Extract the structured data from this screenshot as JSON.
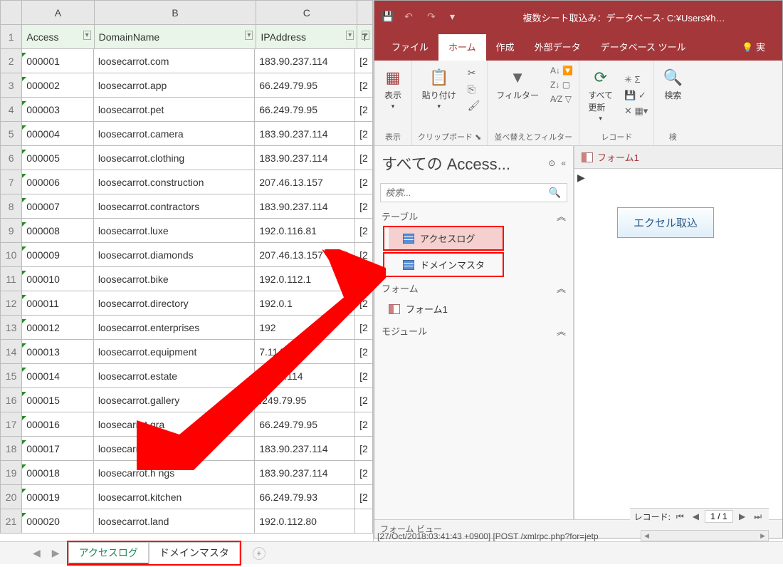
{
  "excel": {
    "columns": [
      "A",
      "B",
      "C",
      ""
    ],
    "headers": [
      "Access",
      "DomainName",
      "IPAddress",
      ""
    ],
    "rows": [
      {
        "n": "1"
      },
      {
        "n": "2",
        "a": "000001",
        "b": "loosecarrot.com",
        "c": "183.90.237.114",
        "d": "[2"
      },
      {
        "n": "3",
        "a": "000002",
        "b": "loosecarrot.app",
        "c": "66.249.79.95",
        "d": "[2"
      },
      {
        "n": "4",
        "a": "000003",
        "b": "loosecarrot.pet",
        "c": "66.249.79.95",
        "d": "[2"
      },
      {
        "n": "5",
        "a": "000004",
        "b": "loosecarrot.camera",
        "c": "183.90.237.114",
        "d": "[2"
      },
      {
        "n": "6",
        "a": "000005",
        "b": "loosecarrot.clothing",
        "c": "183.90.237.114",
        "d": "[2"
      },
      {
        "n": "7",
        "a": "000006",
        "b": "loosecarrot.construction",
        "c": "207.46.13.157",
        "d": "[2"
      },
      {
        "n": "8",
        "a": "000007",
        "b": "loosecarrot.contractors",
        "c": "183.90.237.114",
        "d": "[2"
      },
      {
        "n": "9",
        "a": "000008",
        "b": "loosecarrot.luxe",
        "c": "192.0.116.81",
        "d": "[2"
      },
      {
        "n": "10",
        "a": "000009",
        "b": "loosecarrot.diamonds",
        "c": "207.46.13.157",
        "d": "[2"
      },
      {
        "n": "11",
        "a": "000010",
        "b": "loosecarrot.bike",
        "c": "192.0.112.1",
        "d": "[2"
      },
      {
        "n": "12",
        "a": "000011",
        "b": "loosecarrot.directory",
        "c": "192.0.1",
        "d": "[2"
      },
      {
        "n": "13",
        "a": "000012",
        "b": "loosecarrot.enterprises",
        "c": "192",
        "d": "[2"
      },
      {
        "n": "14",
        "a": "000013",
        "b": "loosecarrot.equipment",
        "c": "7.114",
        "d": "[2"
      },
      {
        "n": "15",
        "a": "000014",
        "b": "loosecarrot.estate",
        "c": "0.237.114",
        "d": "[2"
      },
      {
        "n": "16",
        "a": "000015",
        "b": "loosecarrot.gallery",
        "c": ".249.79.95",
        "d": "[2"
      },
      {
        "n": "17",
        "a": "000016",
        "b": "loosecarrot.gra",
        "c": "66.249.79.95",
        "d": "[2"
      },
      {
        "n": "18",
        "a": "000017",
        "b": "loosecarrot.",
        "c": "183.90.237.114",
        "d": "[2"
      },
      {
        "n": "19",
        "a": "000018",
        "b": "loosecarrot.h      ngs",
        "c": "183.90.237.114",
        "d": "[2"
      },
      {
        "n": "20",
        "a": "000019",
        "b": "loosecarrot.kitchen",
        "c": "66.249.79.93",
        "d": "[2"
      },
      {
        "n": "21",
        "a": "000020",
        "b": "loosecarrot.land",
        "c": "192.0.112.80",
        "d": ""
      }
    ],
    "bottom_text": "[27/Oct/2018:03:41:43 +0900]   [POST /xmlrpc.php?for=jetp",
    "tabs": {
      "active": "アクセスログ",
      "other": "ドメインマスタ"
    }
  },
  "access": {
    "title": "複数シート取込み：データベース- C:¥Users¥h…",
    "menutabs": {
      "file": "ファイル",
      "home": "ホーム",
      "create": "作成",
      "external": "外部データ",
      "dbtools": "データベース ツール",
      "tell": "実"
    },
    "ribbon": {
      "view": {
        "btn": "表示",
        "label": "表示"
      },
      "clip": {
        "btn": "貼り付け",
        "label": "クリップボード"
      },
      "filter": {
        "btn": "フィルター",
        "label": "並べ替えとフィルター"
      },
      "refresh": {
        "btn": "すべて\n更新",
        "label": "レコード"
      },
      "find": {
        "btn": "検索",
        "label": "検"
      }
    },
    "nav": {
      "title": "すべての Access...",
      "search_placeholder": "検索...",
      "cats": {
        "tables": "テーブル",
        "forms": "フォーム",
        "modules": "モジュール"
      },
      "items": {
        "accesslog": "アクセスログ",
        "domainmaster": "ドメインマスタ",
        "form1": "フォーム1"
      }
    },
    "form": {
      "tab": "フォーム1",
      "button": "エクセル取込"
    },
    "record": {
      "label": "レコード:",
      "pos": "1 / 1"
    },
    "status": "フォーム ビュー"
  }
}
